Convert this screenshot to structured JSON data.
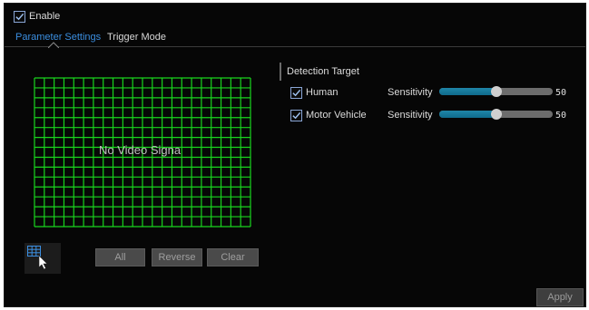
{
  "enable": {
    "label": "Enable",
    "checked": true
  },
  "tabs": [
    {
      "label": "Parameter Settings",
      "active": true
    },
    {
      "label": "Trigger Mode",
      "active": false
    }
  ],
  "video": {
    "overlay_text": "No Video Signa",
    "grid_color": "#19d41e"
  },
  "area_buttons": {
    "all": "All",
    "reverse": "Reverse",
    "clear": "Clear"
  },
  "detection": {
    "title": "Detection Target",
    "targets": [
      {
        "label": "Human",
        "checked": true,
        "sensitivity_label": "Sensitivity",
        "value": "50",
        "level": 0.5
      },
      {
        "label": "Motor Vehicle",
        "checked": true,
        "sensitivity_label": "Sensitivity",
        "value": "50",
        "level": 0.5
      }
    ]
  },
  "apply_label": "Apply",
  "colors": {
    "accent": "#3b8ee0",
    "slider_fill": "#1680a8",
    "grid": "#19d41e"
  }
}
